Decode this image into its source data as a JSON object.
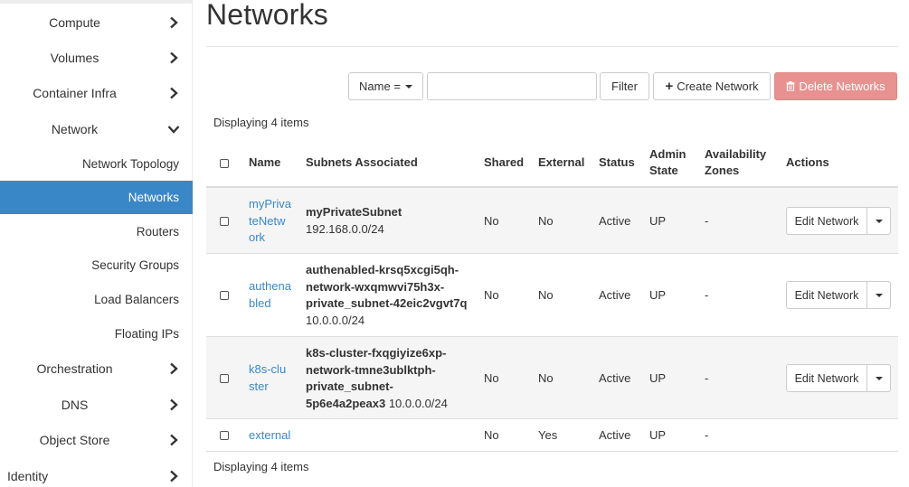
{
  "sidebar": {
    "items": [
      {
        "label": "Compute"
      },
      {
        "label": "Volumes"
      },
      {
        "label": "Container Infra"
      },
      {
        "label": "Network"
      },
      {
        "label": "Network Topology"
      },
      {
        "label": "Networks"
      },
      {
        "label": "Routers"
      },
      {
        "label": "Security Groups"
      },
      {
        "label": "Load Balancers"
      },
      {
        "label": "Floating IPs"
      },
      {
        "label": "Orchestration"
      },
      {
        "label": "DNS"
      },
      {
        "label": "Object Store"
      },
      {
        "label": "Identity"
      }
    ]
  },
  "page": {
    "title": "Networks",
    "count_text_top": "Displaying 4 items",
    "count_text_bottom": "Displaying 4 items"
  },
  "toolbar": {
    "filter_select": "Name =",
    "filter_input_value": "",
    "filter_label": "Filter",
    "create_label": "Create Network",
    "delete_label": "Delete Networks"
  },
  "table": {
    "headers": {
      "name": "Name",
      "subnets": "Subnets Associated",
      "shared": "Shared",
      "external": "External",
      "status": "Status",
      "admin_state_1": "Admin",
      "admin_state_2": "State",
      "availability_1": "Availability",
      "availability_2": "Zones",
      "actions": "Actions"
    },
    "rows": [
      {
        "name_lines": [
          "myPriva",
          "teNetw",
          "ork"
        ],
        "subnet_name": "myPrivateSubnet",
        "subnet_lines": [
          "myPrivateSubnet"
        ],
        "subnet_cidr": "192.168.0.0/24",
        "shared": "No",
        "external": "No",
        "status": "Active",
        "admin_state": "UP",
        "zones": "-",
        "action": "Edit Network"
      },
      {
        "name_lines": [
          "authena",
          "bled"
        ],
        "subnet_lines": [
          "authenabled-krsq5xcgi5qh-",
          "network-wxqmwvi75h3x-",
          "private_subnet-42eic2vgvt7q"
        ],
        "subnet_cidr": "10.0.0.0/24",
        "shared": "No",
        "external": "No",
        "status": "Active",
        "admin_state": "UP",
        "zones": "-",
        "action": "Edit Network"
      },
      {
        "name_lines": [
          "k8s-clu",
          "ster"
        ],
        "subnet_lines": [
          "k8s-cluster-fxqgiyize6xp-",
          "network-tmne3ublktph-",
          "private_subnet-"
        ],
        "subnet_last_bold": "5p6e4a2peax3",
        "subnet_cidr": "10.0.0.0/24",
        "shared": "No",
        "external": "No",
        "status": "Active",
        "admin_state": "UP",
        "zones": "-",
        "action": "Edit Network"
      },
      {
        "name_lines": [
          "external"
        ],
        "shared": "No",
        "external": "Yes",
        "status": "Active",
        "admin_state": "UP",
        "zones": "-"
      }
    ]
  }
}
